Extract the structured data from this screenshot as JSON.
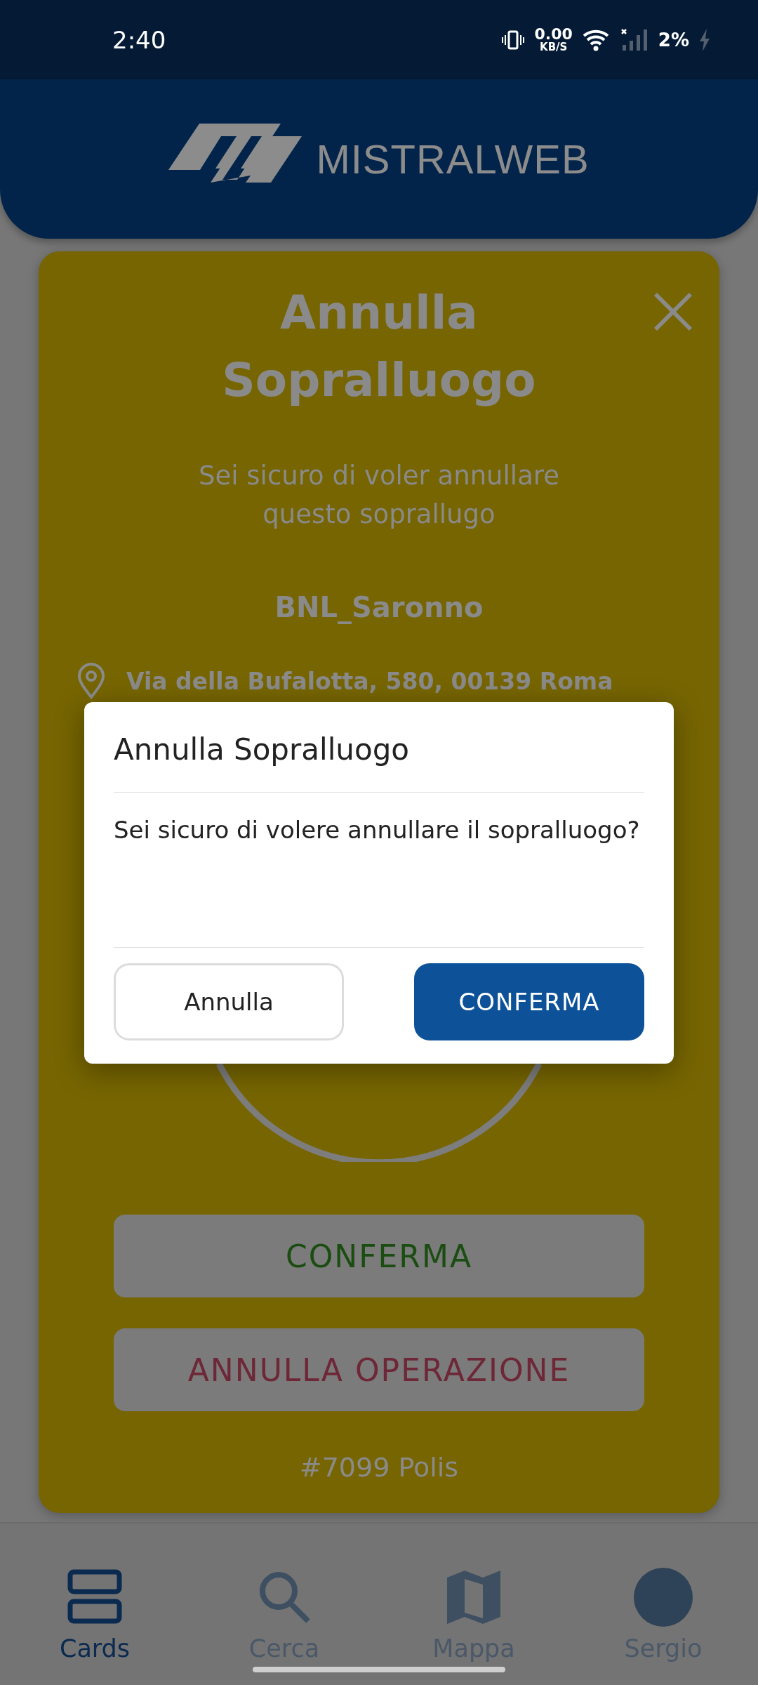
{
  "status_bar": {
    "time": "2:40",
    "net_speed": "0.00",
    "net_unit": "KB/S",
    "battery": "2%"
  },
  "header": {
    "logo_text": "MISTRALWEB"
  },
  "card": {
    "title": "Annulla Sopralluogo",
    "subtitle": "Sei sicuro di voler annullare questo soprallugo",
    "site": "BNL_Saronno",
    "address": "Via della Bufalotta, 580, 00139 Roma",
    "buttons": [
      {
        "label": "CONFERMA",
        "kind": "confirm"
      },
      {
        "label": "ANNULLA OPERAZIONE",
        "kind": "cancel"
      }
    ],
    "footer": "#7099 Polis"
  },
  "dialog": {
    "title": "Annulla Sopralluogo",
    "message": "Sei sicuro di volere annullare il sopralluogo?",
    "buttons": [
      {
        "label": "Annulla",
        "kind": "secondary"
      },
      {
        "label": "CONFERMA",
        "kind": "primary"
      }
    ]
  },
  "nav": {
    "items": [
      {
        "label": "Cards",
        "kind": "cards",
        "selected": true
      },
      {
        "label": "Cerca",
        "kind": "search",
        "selected": false
      },
      {
        "label": "Mappa",
        "kind": "map",
        "selected": false
      },
      {
        "label": "Sergio",
        "kind": "avatar",
        "selected": false
      }
    ]
  }
}
